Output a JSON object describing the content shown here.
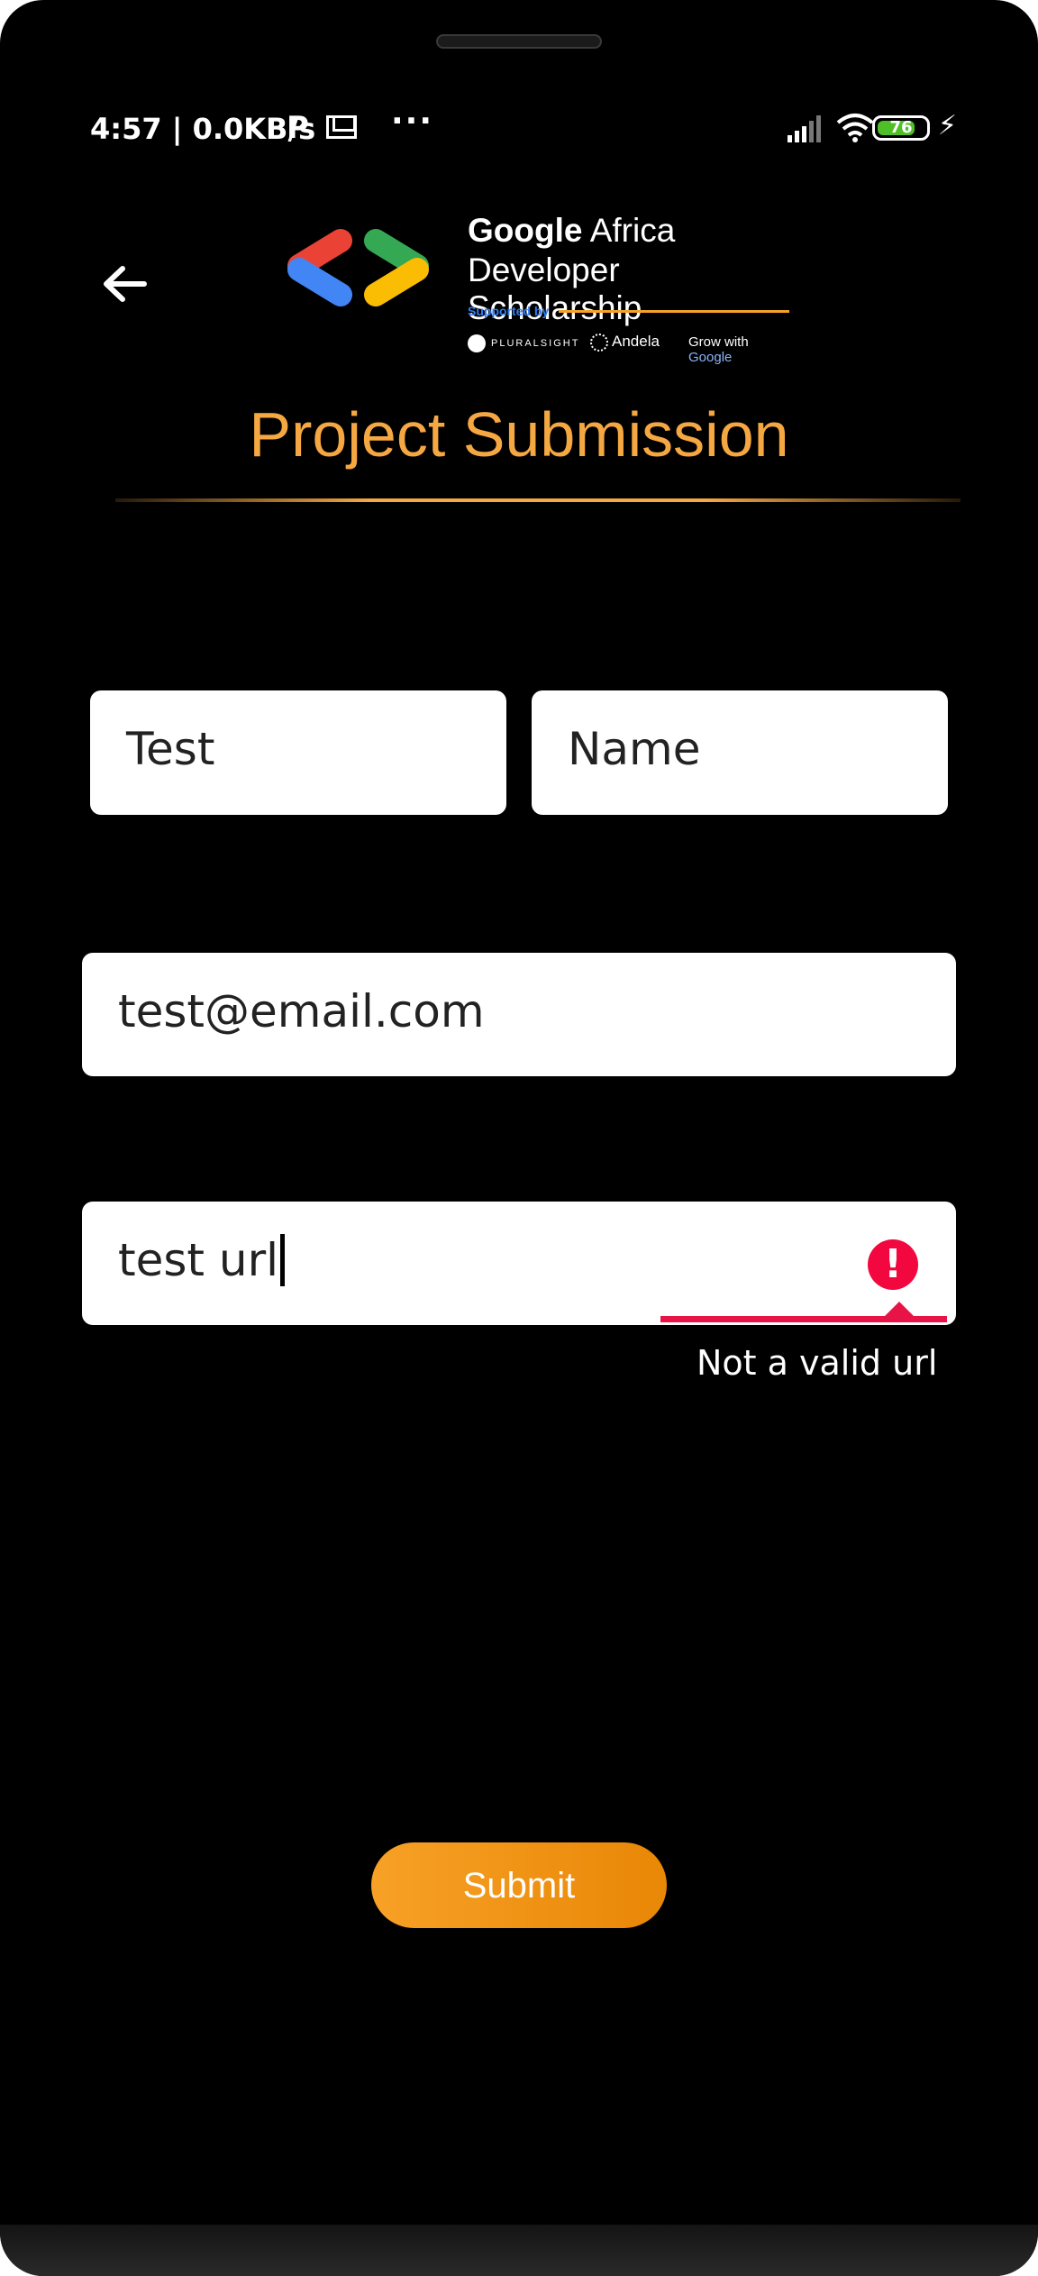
{
  "status_bar": {
    "time_speed": "4:57 | 0.0KB/s",
    "notification_p": "P",
    "more": "···",
    "battery_level": "76",
    "icons": [
      "p-icon",
      "mail-icon",
      "more-icon",
      "signal-icon",
      "wifi-icon",
      "battery-icon",
      "bolt-icon"
    ]
  },
  "header": {
    "back_icon": "back-arrow-icon",
    "logo": {
      "line1_bold": "Google",
      "line1_rest": " Africa",
      "line2": "Developer Scholarship",
      "supported_by": "Supported by",
      "partner1": "PLURALSIGHT",
      "partner2": "Andela",
      "partner3_prefix": "Grow with ",
      "partner3_brand": "Google"
    }
  },
  "title": "Project Submission",
  "form": {
    "first_name": "Test",
    "last_name": "Name",
    "email": "test@email.com",
    "url": "test url",
    "url_error": "Not a valid url",
    "submit_label": "Submit"
  },
  "colors": {
    "accent": "#f5a742",
    "error": "#f2073f",
    "background": "#000000",
    "field": "#ffffff"
  }
}
